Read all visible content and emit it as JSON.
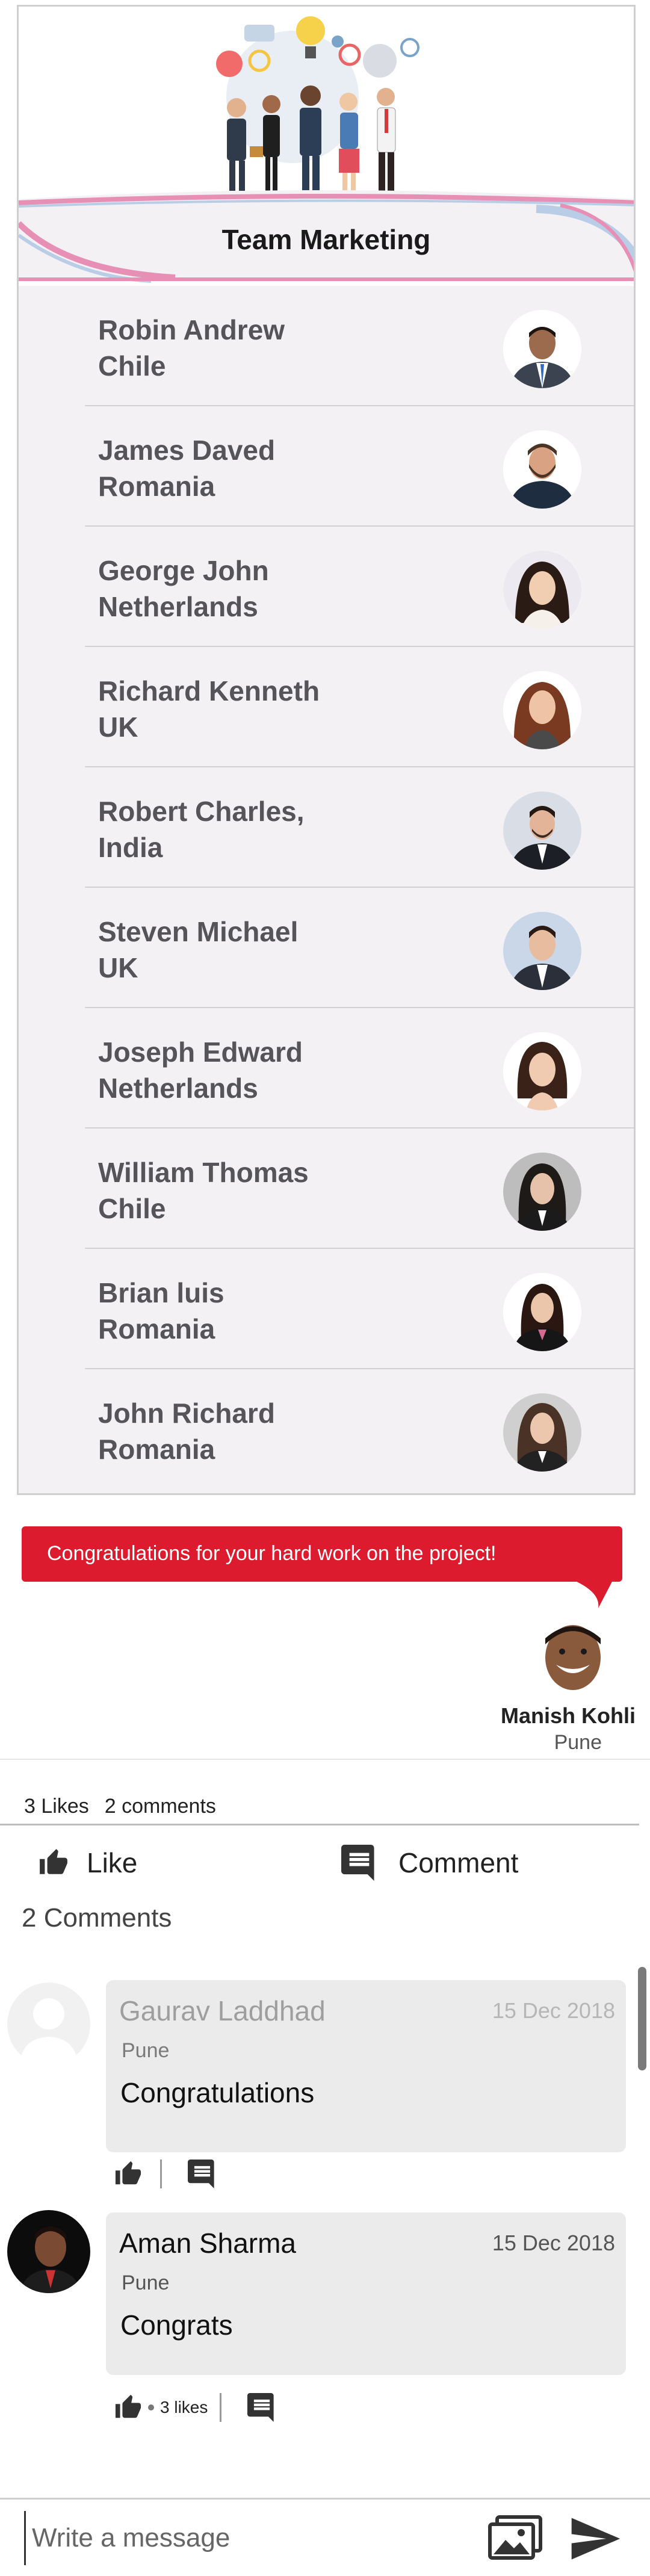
{
  "team": {
    "title": "Team Marketing",
    "members": [
      {
        "name": "Robin Andrew",
        "country": "Chile"
      },
      {
        "name": "James Daved",
        "country": "Romania"
      },
      {
        "name": "George John",
        "country": "Netherlands"
      },
      {
        "name": "Richard Kenneth",
        "country": "UK"
      },
      {
        "name": "Robert Charles,",
        "country": "India"
      },
      {
        "name": "Steven Michael",
        "country": "UK"
      },
      {
        "name": "Joseph Edward",
        "country": "Netherlands"
      },
      {
        "name": "William Thomas",
        "country": "Chile"
      },
      {
        "name": "Brian luis",
        "country": "Romania"
      },
      {
        "name": "John Richard",
        "country": "Romania"
      }
    ]
  },
  "post": {
    "message": "Congratulations for your hard work on the project!",
    "sender_name": "Manish Kohli",
    "sender_city": "Pune"
  },
  "stats": {
    "likes": "3 Likes",
    "comments": "2 comments"
  },
  "actions": {
    "like_label": "Like",
    "comment_label": "Comment",
    "like_icon": "thumbs-up-icon",
    "comment_icon": "comment-icon"
  },
  "comments_heading": "2 Comments",
  "comments": [
    {
      "author": "Gaurav Laddhad",
      "date": "15 Dec 2018",
      "city": "Pune",
      "text": "Congratulations"
    },
    {
      "author": "Aman Sharma",
      "date": "15 Dec 2018",
      "city": "Pune",
      "text": "Congrats",
      "likes": "3 likes"
    }
  ],
  "composer": {
    "placeholder": "Write a message",
    "gallery_icon": "image-gallery-icon",
    "send_icon": "send-icon"
  },
  "colors": {
    "accent_red": "#dc1c2e",
    "list_bg": "#f3f1f4",
    "comment_bg": "#ebebeb"
  }
}
